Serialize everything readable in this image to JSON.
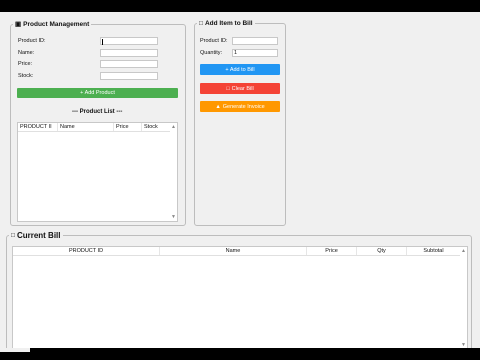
{
  "product_management": {
    "title": "Product Management",
    "labels": {
      "id": "Product ID:",
      "name": "Name:",
      "price": "Price:",
      "stock": "Stock:"
    },
    "values": {
      "id": "",
      "name": "",
      "price": "",
      "stock": ""
    },
    "add_button": "+ Add Product",
    "list_title": "--- Product List ---",
    "columns": [
      "PRODUCT II",
      "Name",
      "Price",
      "Stock"
    ]
  },
  "add_to_bill": {
    "title": "Add Item to Bill",
    "labels": {
      "id": "Product ID:",
      "qty": "Quantity:"
    },
    "values": {
      "id": "",
      "qty": "1"
    },
    "add_button": "+ Add to Bill",
    "clear_button": "Clear Bill",
    "invoice_button": "Generate Invoice"
  },
  "current_bill": {
    "title": "Current Bill",
    "columns": [
      "PRODUCT ID",
      "Name",
      "Price",
      "Qty",
      "Subtotal"
    ]
  },
  "colors": {
    "green": "#4caf50",
    "blue": "#2196f3",
    "red": "#f44336",
    "orange": "#ff9800"
  },
  "icons": {
    "product_management": "box-icon",
    "add_to_bill": "cart-icon",
    "current_bill": "receipt-icon",
    "clear": "trash-icon",
    "invoice": "document-icon"
  }
}
